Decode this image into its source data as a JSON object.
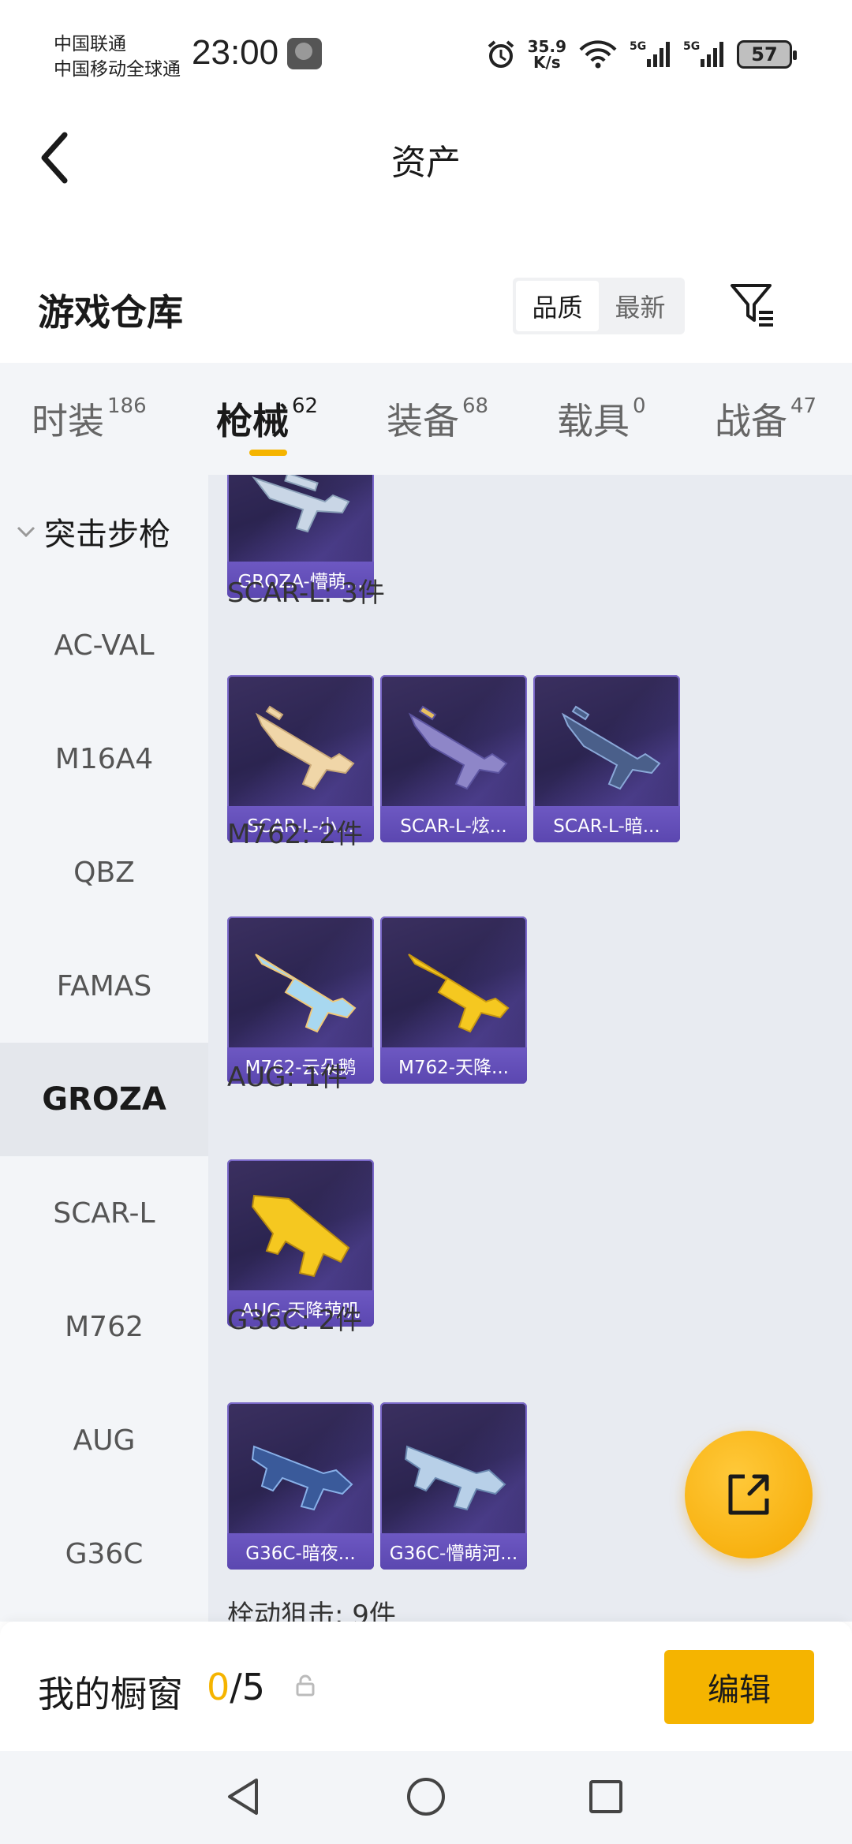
{
  "status_bar": {
    "carrier_1": "中国联通",
    "carrier_2": "中国移动全球通",
    "time": "23:00",
    "net_speed_value": "35.9",
    "net_speed_unit": "K/s",
    "battery": "57"
  },
  "header": {
    "title": "资产"
  },
  "warehouse": {
    "title": "游戏仓库",
    "sort_options": [
      "品质",
      "最新"
    ],
    "sort_active": "品质"
  },
  "category_tabs": [
    {
      "label": "时装",
      "count": "186"
    },
    {
      "label": "枪械",
      "count": "62"
    },
    {
      "label": "装备",
      "count": "68"
    },
    {
      "label": "载具",
      "count": "0"
    },
    {
      "label": "战备",
      "count": "47"
    }
  ],
  "active_category": "枪械",
  "sidebar": {
    "group": "突击步枪",
    "items": [
      "AC-VAL",
      "M16A4",
      "QBZ",
      "FAMAS",
      "GROZA",
      "SCAR-L",
      "M762",
      "AUG",
      "G36C"
    ],
    "active": "GROZA"
  },
  "content": {
    "top_card_name": "GROZA-懵萌...",
    "groups": [
      {
        "label": "SCAR-L: 3件",
        "items": [
          "SCAR-L-小...",
          "SCAR-L-炫...",
          "SCAR-L-暗..."
        ]
      },
      {
        "label": "M762: 2件",
        "items": [
          "M762-云朵鹅",
          "M762-天降..."
        ]
      },
      {
        "label": "AUG: 1件",
        "items": [
          "AUG-天降萌叽"
        ]
      },
      {
        "label": "G36C: 2件",
        "items": [
          "G36C-暗夜...",
          "G36C-懵萌河..."
        ]
      }
    ],
    "next_group_label": "栓动狙击: 9件"
  },
  "showcase": {
    "title": "我的橱窗",
    "used": "0",
    "total_text": "/5",
    "edit_label": "编辑"
  },
  "colors": {
    "accent": "#f5b400",
    "card_bg": "#2b2450",
    "card_label": "#5b47b0"
  },
  "icons": {
    "back": "chevron-left-icon",
    "filter": "filter-icon",
    "fab": "share-external-icon",
    "lock": "lock-icon"
  }
}
